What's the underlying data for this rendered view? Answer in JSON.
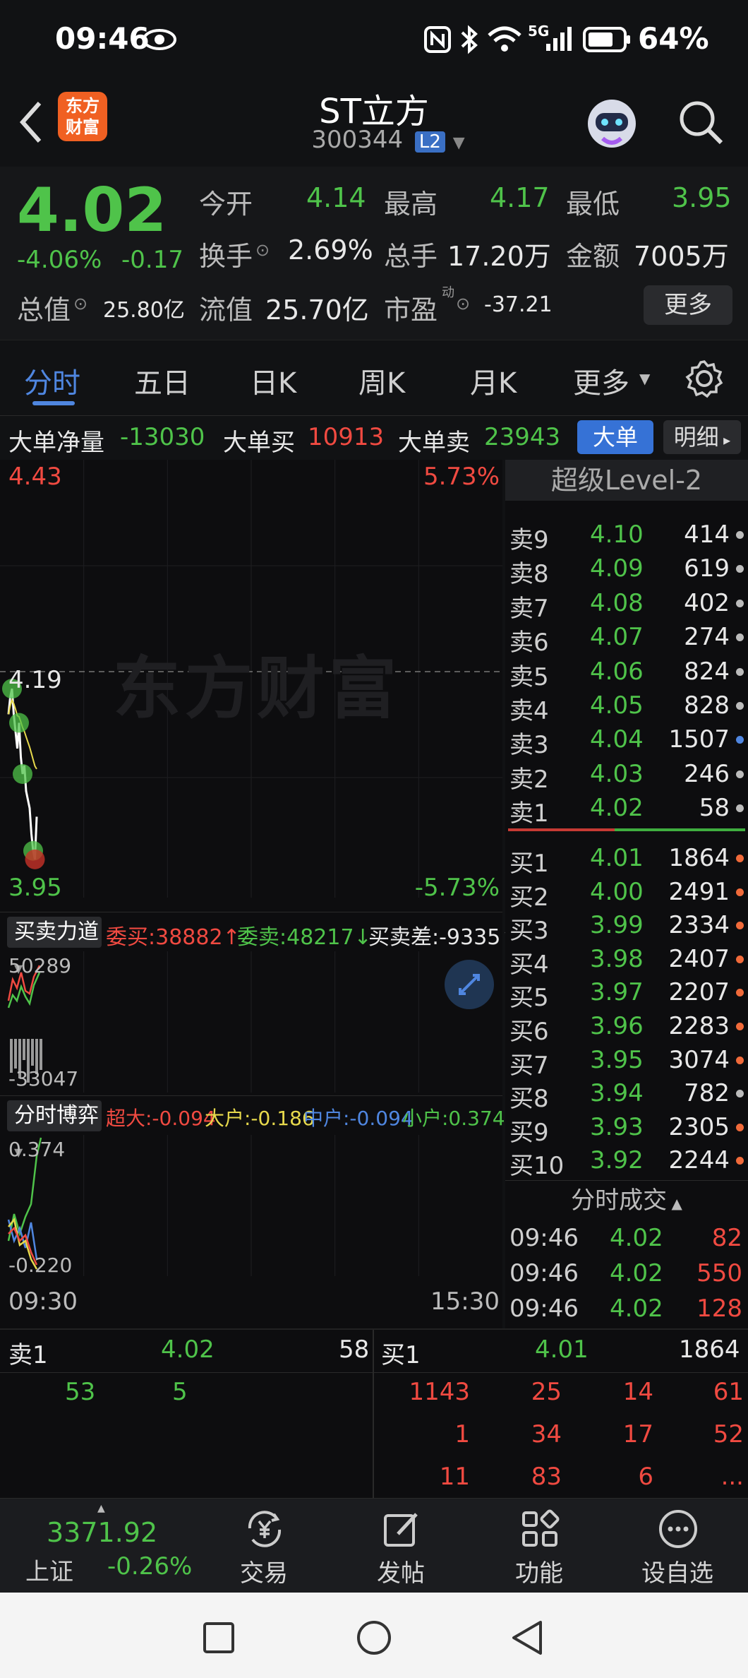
{
  "status": {
    "time": "09:46",
    "signal": "5G",
    "battery": "64%"
  },
  "header": {
    "stock_name": "ST立方",
    "code": "300344",
    "level_badge": "L2",
    "app_logo": "东方财富"
  },
  "quote": {
    "price": "4.02",
    "change_pct": "-4.06%",
    "change": "-0.17",
    "open_label": "今开",
    "open": "4.14",
    "high_label": "最高",
    "high": "4.17",
    "low_label": "最低",
    "low": "3.95",
    "turnover_label": "换手",
    "turnover": "2.69%",
    "volume_label": "总手",
    "volume": "17.20万",
    "amount_label": "金额",
    "amount": "7005万",
    "mktcap_label": "总值",
    "mktcap": "25.80亿",
    "float_label": "流值",
    "float_cap": "25.70亿",
    "pe_label": "市盈",
    "pe_sup": "动",
    "pe": "-37.21",
    "more_button": "更多"
  },
  "tabs": {
    "items": [
      "分时",
      "五日",
      "日K",
      "周K",
      "月K",
      "更多"
    ]
  },
  "big_order": {
    "net_label": "大单净量",
    "net": "-13030",
    "buy_label": "大单买",
    "buy": "10913",
    "sell_label": "大单卖",
    "sell": "23943",
    "btn_big": "大单",
    "btn_detail": "明细"
  },
  "chart": {
    "watermark": "东方财富",
    "y_max": "4.43",
    "y_max_pct": "5.73%",
    "y_prev": "4.19",
    "y_min": "3.95",
    "y_min_pct": "-5.73%",
    "t_start": "09:30",
    "t_end": "15:30",
    "colors": {
      "up": "#f04a41",
      "down": "#4fc34a",
      "price_line": "#ffffff",
      "avg_line": "#e7d94c"
    }
  },
  "chart_data": [
    {
      "type": "line",
      "title": "",
      "x": [
        "09:30",
        "09:31",
        "09:32",
        "09:33",
        "09:34",
        "09:35",
        "09:36",
        "09:37",
        "09:38",
        "09:39",
        "09:40",
        "09:41",
        "09:42",
        "09:43",
        "09:44",
        "09:45",
        "09:46"
      ],
      "series": [
        {
          "values": [
            4.14,
            4.16,
            4.17,
            4.14,
            4.12,
            4.1,
            4.13,
            4.09,
            4.07,
            4.08,
            4.05,
            4.04,
            4.03,
            4.0,
            3.98,
            3.97,
            4.02
          ]
        }
      ],
      "ylim": [
        3.95,
        4.43
      ]
    },
    {
      "type": "line",
      "title": "",
      "ylim": [
        -33047,
        50289
      ]
    },
    {
      "type": "line",
      "title": "",
      "ylim": [
        -0.22,
        0.374
      ]
    }
  ],
  "force": {
    "menu": "买卖力道",
    "wei_buy_label": "委买:",
    "wei_buy": "38882",
    "wei_sell_label": "委卖:",
    "wei_sell": "48217",
    "diff_label": "买卖差:",
    "diff": "-9335",
    "y_top": "50289",
    "y_bottom": "-33047"
  },
  "game": {
    "menu": "分时博弈",
    "super": "超大:-0.094",
    "large": "大户:-0.186",
    "mid": "中户:-0.094",
    "small": "小户:0.374",
    "y_top": "0.374",
    "y_bottom": "-0.220"
  },
  "l2": {
    "title": "超级Level-2",
    "sells": [
      {
        "label": "卖9",
        "price": "4.10",
        "vol": "414",
        "dot": "#bbbbbb"
      },
      {
        "label": "卖8",
        "price": "4.09",
        "vol": "619",
        "dot": "#bbbbbb"
      },
      {
        "label": "卖7",
        "price": "4.08",
        "vol": "402",
        "dot": "#bbbbbb"
      },
      {
        "label": "卖6",
        "price": "4.07",
        "vol": "274",
        "dot": "#bbbbbb"
      },
      {
        "label": "卖5",
        "price": "4.06",
        "vol": "824",
        "dot": "#bbbbbb"
      },
      {
        "label": "卖4",
        "price": "4.05",
        "vol": "828",
        "dot": "#bbbbbb"
      },
      {
        "label": "卖3",
        "price": "4.04",
        "vol": "1507",
        "dot": "#4f86e0"
      },
      {
        "label": "卖2",
        "price": "4.03",
        "vol": "246",
        "dot": "#bbbbbb"
      },
      {
        "label": "卖1",
        "price": "4.02",
        "vol": "58",
        "dot": "#bbbbbb"
      }
    ],
    "buys": [
      {
        "label": "买1",
        "price": "4.01",
        "vol": "1864",
        "dot": "#f06a3a"
      },
      {
        "label": "买2",
        "price": "4.00",
        "vol": "2491",
        "dot": "#f06a3a"
      },
      {
        "label": "买3",
        "price": "3.99",
        "vol": "2334",
        "dot": "#f06a3a"
      },
      {
        "label": "买4",
        "price": "3.98",
        "vol": "2407",
        "dot": "#f06a3a"
      },
      {
        "label": "买5",
        "price": "3.97",
        "vol": "2207",
        "dot": "#f06a3a"
      },
      {
        "label": "买6",
        "price": "3.96",
        "vol": "2283",
        "dot": "#f06a3a"
      },
      {
        "label": "买7",
        "price": "3.95",
        "vol": "3074",
        "dot": "#f06a3a"
      },
      {
        "label": "买8",
        "price": "3.94",
        "vol": "782",
        "dot": "#bbbbbb"
      },
      {
        "label": "买9",
        "price": "3.93",
        "vol": "2305",
        "dot": "#f06a3a"
      },
      {
        "label": "买10",
        "price": "3.92",
        "vol": "2244",
        "dot": "#f06a3a"
      }
    ],
    "ticks_title": "分时成交",
    "ticks": [
      {
        "time": "09:46",
        "price": "4.02",
        "vol": "82"
      },
      {
        "time": "09:46",
        "price": "4.02",
        "vol": "550"
      },
      {
        "time": "09:46",
        "price": "4.02",
        "vol": "128"
      }
    ]
  },
  "queue": {
    "sell_label": "卖1",
    "sell_price": "4.02",
    "sell_vol": "58",
    "sell_orders": [
      "53",
      "5"
    ],
    "buy_label": "买1",
    "buy_price": "4.01",
    "buy_vol": "1864",
    "buy_orders": [
      [
        "1143",
        "25",
        "14",
        "61"
      ],
      [
        "1",
        "34",
        "17",
        "52"
      ],
      [
        "11",
        "83",
        "6",
        "..."
      ]
    ]
  },
  "toolbar": {
    "index_value": "3371.92",
    "index_name": "上证",
    "index_change": "-0.26%",
    "trade": "交易",
    "post": "发帖",
    "func": "功能",
    "watch": "设自选"
  }
}
